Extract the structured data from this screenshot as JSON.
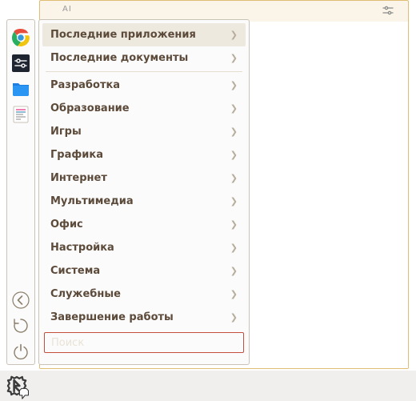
{
  "editor": {
    "toolbar_hint": "AI"
  },
  "menu": {
    "top": [
      {
        "label": "Последние приложения"
      },
      {
        "label": "Последние документы"
      }
    ],
    "categories": [
      {
        "label": "Разработка"
      },
      {
        "label": "Образование"
      },
      {
        "label": "Игры"
      },
      {
        "label": "Графика"
      },
      {
        "label": "Интернет"
      },
      {
        "label": "Мультимедиа"
      },
      {
        "label": "Офис"
      },
      {
        "label": "Настройка"
      },
      {
        "label": "Система"
      },
      {
        "label": "Служебные"
      },
      {
        "label": "Завершение работы"
      }
    ],
    "search_placeholder": "Поиск"
  },
  "sidebar": {
    "apps": [
      {
        "name": "chrome"
      },
      {
        "name": "settings-dark"
      },
      {
        "name": "files"
      },
      {
        "name": "text-document"
      }
    ],
    "controls": [
      {
        "name": "back"
      },
      {
        "name": "restart"
      },
      {
        "name": "power"
      }
    ]
  }
}
